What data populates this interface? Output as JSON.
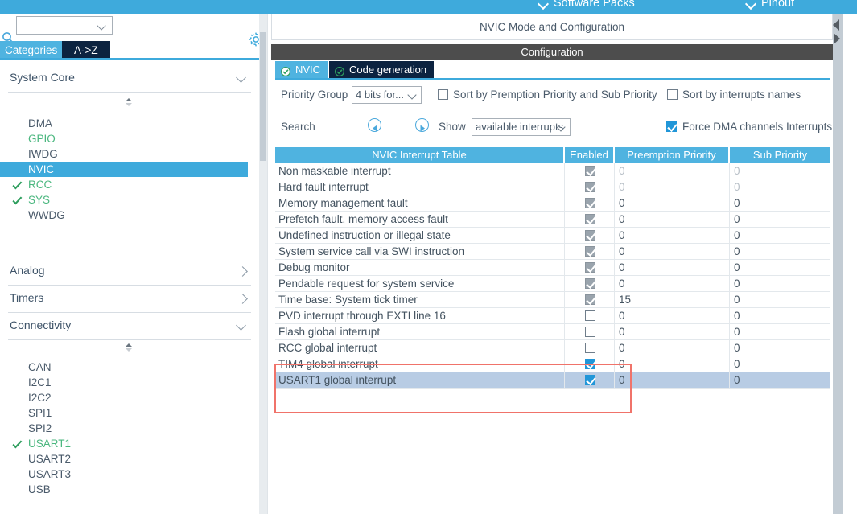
{
  "topbar": {
    "items": [
      {
        "label": "Software Packs",
        "icon": "chevron-down-icon"
      },
      {
        "label": "Pinout",
        "icon": "chevron-down-icon"
      }
    ]
  },
  "sidebar": {
    "search": {
      "value": "",
      "placeholder": "",
      "icon": "search-icon"
    },
    "settings_icon": "gear-icon",
    "tabs": [
      {
        "label": "Categories",
        "selected": true
      },
      {
        "label": "A->Z",
        "selected": false
      }
    ],
    "groups": [
      {
        "label": "System Core",
        "expanded": true,
        "items": [
          {
            "label": "DMA",
            "state": "none"
          },
          {
            "label": "GPIO",
            "state": "configured"
          },
          {
            "label": "IWDG",
            "state": "none"
          },
          {
            "label": "NVIC",
            "state": "selected"
          },
          {
            "label": "RCC",
            "state": "checked"
          },
          {
            "label": "SYS",
            "state": "checked"
          },
          {
            "label": "WWDG",
            "state": "none"
          }
        ]
      },
      {
        "label": "Analog",
        "expanded": false,
        "items": []
      },
      {
        "label": "Timers",
        "expanded": false,
        "items": []
      },
      {
        "label": "Connectivity",
        "expanded": true,
        "items": [
          {
            "label": "CAN",
            "state": "none"
          },
          {
            "label": "I2C1",
            "state": "none"
          },
          {
            "label": "I2C2",
            "state": "none"
          },
          {
            "label": "SPI1",
            "state": "none"
          },
          {
            "label": "SPI2",
            "state": "none"
          },
          {
            "label": "USART1",
            "state": "checked"
          },
          {
            "label": "USART2",
            "state": "none"
          },
          {
            "label": "USART3",
            "state": "none"
          },
          {
            "label": "USB",
            "state": "none"
          }
        ]
      }
    ]
  },
  "panel": {
    "mode_title": "NVIC Mode and Configuration",
    "configuration_title": "Configuration",
    "tabs": [
      {
        "label": "NVIC",
        "active": true,
        "icon": "green-check-icon"
      },
      {
        "label": "Code generation",
        "active": false,
        "icon": "green-check-icon"
      }
    ],
    "options": {
      "priority_group_label": "Priority Group",
      "priority_group_value": "4 bits for...",
      "sort_premption_label": "Sort by Premption Priority and Sub Priority",
      "sort_premption_checked": false,
      "sort_names_label": "Sort by interrupts names",
      "sort_names_checked": false,
      "search_label": "Search",
      "prev_icon": "circle-left-arrow-icon",
      "next_icon": "circle-right-arrow-icon",
      "show_label": "Show",
      "show_value": "available interrupts",
      "force_dma_label": "Force DMA channels Interrupts",
      "force_dma_checked": true
    },
    "table": {
      "headers": [
        "NVIC Interrupt Table",
        "Enabled",
        "Preemption Priority",
        "Sub Priority"
      ],
      "rows": [
        {
          "name": "Non maskable interrupt",
          "enabled": "locked",
          "preemption": "0",
          "sub": "0",
          "dim": true,
          "selected": false
        },
        {
          "name": "Hard fault interrupt",
          "enabled": "locked",
          "preemption": "0",
          "sub": "0",
          "dim": true,
          "selected": false
        },
        {
          "name": "Memory management fault",
          "enabled": "locked",
          "preemption": "0",
          "sub": "0",
          "dim": false,
          "selected": false
        },
        {
          "name": "Prefetch fault, memory access fault",
          "enabled": "locked",
          "preemption": "0",
          "sub": "0",
          "dim": false,
          "selected": false
        },
        {
          "name": "Undefined instruction or illegal state",
          "enabled": "locked",
          "preemption": "0",
          "sub": "0",
          "dim": false,
          "selected": false
        },
        {
          "name": "System service call via SWI instruction",
          "enabled": "locked",
          "preemption": "0",
          "sub": "0",
          "dim": false,
          "selected": false
        },
        {
          "name": "Debug monitor",
          "enabled": "locked",
          "preemption": "0",
          "sub": "0",
          "dim": false,
          "selected": false
        },
        {
          "name": "Pendable request for system service",
          "enabled": "locked",
          "preemption": "0",
          "sub": "0",
          "dim": false,
          "selected": false
        },
        {
          "name": "Time base: System tick timer",
          "enabled": "locked",
          "preemption": "15",
          "sub": "0",
          "dim": false,
          "selected": false
        },
        {
          "name": "PVD interrupt through EXTI line 16",
          "enabled": "unchecked",
          "preemption": "0",
          "sub": "0",
          "dim": false,
          "selected": false
        },
        {
          "name": "Flash global interrupt",
          "enabled": "unchecked",
          "preemption": "0",
          "sub": "0",
          "dim": false,
          "selected": false
        },
        {
          "name": "RCC global interrupt",
          "enabled": "unchecked",
          "preemption": "0",
          "sub": "0",
          "dim": false,
          "selected": false
        },
        {
          "name": "TIM4 global interrupt",
          "enabled": "checked",
          "preemption": "0",
          "sub": "0",
          "dim": false,
          "selected": false
        },
        {
          "name": "USART1 global interrupt",
          "enabled": "checked",
          "preemption": "0",
          "sub": "0",
          "dim": false,
          "selected": true
        }
      ]
    }
  },
  "annotation": {
    "shape": "rectangle",
    "color": "#f0736a"
  },
  "colors": {
    "accent_blue": "#3eaadc",
    "tab_blue": "#4fb3e0",
    "navy": "#0c2340",
    "green": "#4bb77f",
    "row_selected": "#b8cce4",
    "annotation_red": "#f0736a"
  }
}
